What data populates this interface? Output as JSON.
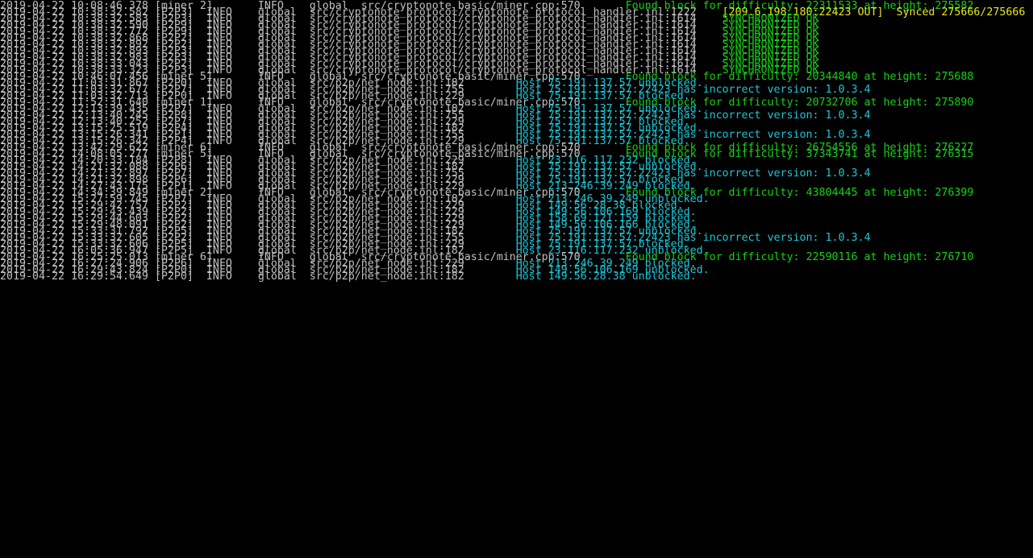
{
  "colors": {
    "background": "#000000",
    "default_text": "#c0c0c0",
    "green": "#16d116",
    "yellow": "#e8e81a",
    "cyan": "#19c8d8"
  },
  "lines": [
    {
      "prefix": "2019-04-22 10:08:46.378 [miner 2]       INFO    global  src/cryptonote_basic/miner.cpp:570       ",
      "msg": "Found block for difficulty: 22311533 at height: 275582",
      "color": "green"
    },
    {
      "prefix": "2019-04-22 10:38:32.582 [P2P3]  INFO    global  src/cryptonote_protocol/cryptonote_protocol_handler.inl:1222    ",
      "msg": "[209.6.198.180:22423 OUT]  Synced 275666/275666",
      "color": "yellow"
    },
    {
      "prefix": "2019-04-22 10:38:32.583 [P2P3]  INFO    global  src/cryptonote_protocol/cryptonote_protocol_handler.inl:1614    ",
      "msg": "SYNCHRONIZED OK",
      "color": "green"
    },
    {
      "prefix": "2019-04-22 10:38:32.590 [P2P9]  INFO    global  src/cryptonote_protocol/cryptonote_protocol_handler.inl:1614    ",
      "msg": "SYNCHRONIZED OK",
      "color": "green"
    },
    {
      "prefix": "2019-04-22 10:38:32.772 [P2P9]  INFO    global  src/cryptonote_protocol/cryptonote_protocol_handler.inl:1614    ",
      "msg": "SYNCHRONIZED OK",
      "color": "green"
    },
    {
      "prefix": "2019-04-22 10:38:32.868 [P2P2]  INFO    global  src/cryptonote_protocol/cryptonote_protocol_handler.inl:1614    ",
      "msg": "SYNCHRONIZED OK",
      "color": "green"
    },
    {
      "prefix": "2019-04-22 10:38:32.892 [P2P2]  INFO    global  src/cryptonote_protocol/cryptonote_protocol_handler.inl:1614    ",
      "msg": "SYNCHRONIZED OK",
      "color": "green"
    },
    {
      "prefix": "2019-04-22 10:38:32.893 [P2P3]  INFO    global  src/cryptonote_protocol/cryptonote_protocol_handler.inl:1614    ",
      "msg": "SYNCHRONIZED OK",
      "color": "green"
    },
    {
      "prefix": "2019-04-22 10:38:32.983 [P2P3]  INFO    global  src/cryptonote_protocol/cryptonote_protocol_handler.inl:1614    ",
      "msg": "SYNCHRONIZED OK",
      "color": "green"
    },
    {
      "prefix": "2019-04-22 10:38:33.043 [P2P2]  INFO    global  src/cryptonote_protocol/cryptonote_protocol_handler.inl:1614    ",
      "msg": "SYNCHRONIZED OK",
      "color": "green"
    },
    {
      "prefix": "2019-04-22 10:38:33.323 [P2P3]  INFO    global  src/cryptonote_protocol/cryptonote_protocol_handler.inl:1614    ",
      "msg": "SYNCHRONIZED OK",
      "color": "green"
    },
    {
      "prefix": "2019-04-22 10:46:07.456 [miner 5]       INFO    global  src/cryptonote_basic/miner.cpp:570       ",
      "msg": "Found block for difficulty: 20344840 at height: 275688",
      "color": "green"
    },
    {
      "prefix": "2019-04-22 11:03:31.867 [P2P0]  INFO    global  src/p2p/net_node.inl:182        ",
      "msg": "Host 75.191.137.57 unblocked.",
      "color": "cyan"
    },
    {
      "prefix": "2019-04-22 11:03:32.677 [P2P7]  INFO    global  src/p2p/net_node.inl:755        ",
      "msg": "Host 75.191.137.57:22423 has incorrect version: 1.0.3.4",
      "color": "cyan"
    },
    {
      "prefix": "2019-04-22 11:03:32.713 [P2P0]  INFO    global  src/p2p/net_node.inl:229        ",
      "msg": "Host 75.191.137.57 blocked.",
      "color": "cyan"
    },
    {
      "prefix": "2019-04-22 11:52:31.640 [miner 1]       INFO    global  src/cryptonote_basic/miner.cpp:570       ",
      "msg": "Found block for difficulty: 20732706 at height: 275890",
      "color": "green"
    },
    {
      "prefix": "2019-04-22 12:13:39.435 [P2P7]  INFO    global  src/p2p/net_node.inl:182        ",
      "msg": "Host 75.191.137.57 unblocked.",
      "color": "cyan"
    },
    {
      "prefix": "2019-04-22 12:13:40.245 [P2P8]  INFO    global  src/p2p/net_node.inl:755        ",
      "msg": "Host 75.191.137.57:22423 has incorrect version: 1.0.3.4",
      "color": "cyan"
    },
    {
      "prefix": "2019-04-22 12:13:40.252 [P2P7]  INFO    global  src/p2p/net_node.inl:229        ",
      "msg": "Host 75.191.137.57 blocked.",
      "color": "cyan"
    },
    {
      "prefix": "2019-04-22 13:15:25.519 [P2P4]  INFO    global  src/p2p/net_node.inl:182        ",
      "msg": "Host 75.191.137.57 unblocked.",
      "color": "cyan"
    },
    {
      "prefix": "2019-04-22 13:15:26.341 [P2P1]  INFO    global  src/p2p/net_node.inl:755        ",
      "msg": "Host 75.191.137.57:22423 has incorrect version: 1.0.3.4",
      "color": "cyan"
    },
    {
      "prefix": "2019-04-22 13:15:26.342 [P2P4]  INFO    global  src/p2p/net_node.inl:229        ",
      "msg": "Host 75.191.137.57 blocked.",
      "color": "cyan"
    },
    {
      "prefix": "2019-04-22 13:42:29.622 [miner 6]       INFO    global  src/cryptonote_basic/miner.cpp:570       ",
      "msg": "Found block for difficulty: 26754556 at height: 276227",
      "color": "green"
    },
    {
      "prefix": "2019-04-22 14:08:05.277 [miner 5]       INFO    global  src/cryptonote_basic/miner.cpp:570       ",
      "msg": "Found block for difficulty: 37343741 at height: 276315",
      "color": "green"
    },
    {
      "prefix": "2019-04-22 14:20:33.184 [P2P8]  INFO    global  src/p2p/net_node.inl:229        ",
      "msg": "Host 23.116.117.232 blocked.",
      "color": "cyan"
    },
    {
      "prefix": "2019-04-22 14:21:32.088 [P2P6]  INFO    global  src/p2p/net_node.inl:182        ",
      "msg": "Host 75.191.137.57 unblocked.",
      "color": "cyan"
    },
    {
      "prefix": "2019-04-22 14:21:32.897 [P2P7]  INFO    global  src/p2p/net_node.inl:755        ",
      "msg": "Host 75.191.137.57:22423 has incorrect version: 1.0.3.4",
      "color": "cyan"
    },
    {
      "prefix": "2019-04-22 14:21:32.898 [P2P6]  INFO    global  src/p2p/net_node.inl:229        ",
      "msg": "Host 75.191.137.57 blocked.",
      "color": "cyan"
    },
    {
      "prefix": "2019-04-22 14:27:43.175 [P2P1]  INFO    global  src/p2p/net_node.inl:229        ",
      "msg": "Host 213.246.39.249 blocked.",
      "color": "cyan"
    },
    {
      "prefix": "2019-04-22 14:34:39.849 [miner 2]       INFO    global  src/cryptonote_basic/miner.cpp:570       ",
      "msg": "Found block for difficulty: 43804445 at height: 276399",
      "color": "green"
    },
    {
      "prefix": "2019-04-22 15:27:59.745 [P2P7]  INFO    global  src/p2p/net_node.inl:182        ",
      "msg": "Host 213.246.39.249 unblocked.",
      "color": "cyan"
    },
    {
      "prefix": "2019-04-22 15:29:42.757 [P2P2]  INFO    global  src/p2p/net_node.inl:229        ",
      "msg": "Host 149.56.28.38 blocked.",
      "color": "cyan"
    },
    {
      "prefix": "2019-04-22 15:29:43.439 [P2P2]  INFO    global  src/p2p/net_node.inl:229        ",
      "msg": "Host 149.56.106.169 blocked.",
      "color": "cyan"
    },
    {
      "prefix": "2019-04-22 15:29:44.603 [P2P2]  INFO    global  src/p2p/net_node.inl:229        ",
      "msg": "Host 158.69.121.159 blocked.",
      "color": "cyan"
    },
    {
      "prefix": "2019-04-22 15:29:48.091 [P2P2]  INFO    global  src/p2p/net_node.inl:229        ",
      "msg": "Host 149.56.106.166 blocked.",
      "color": "cyan"
    },
    {
      "prefix": "2019-04-22 15:33:31.792 [P2P5]  INFO    global  src/p2p/net_node.inl:182        ",
      "msg": "Host 75.191.137.57 unblocked.",
      "color": "cyan"
    },
    {
      "prefix": "2019-04-22 15:33:32.605 [P2P2]  INFO    global  src/p2p/net_node.inl:755        ",
      "msg": "Host 75.191.137.57:22423 has incorrect version: 1.0.3.4",
      "color": "cyan"
    },
    {
      "prefix": "2019-04-22 15:33:32.606 [P2P5]  INFO    global  src/p2p/net_node.inl:229        ",
      "msg": "Host 75.191.137.57 blocked.",
      "color": "cyan"
    },
    {
      "prefix": "2019-04-22 16:05:36.947 [P2P5]  INFO    global  src/p2p/net_node.inl:182        ",
      "msg": "Host 23.116.117.232 unblocked.",
      "color": "cyan"
    },
    {
      "prefix": "2019-04-22 16:25:25.013 [miner 6]       INFO    global  src/cryptonote_basic/miner.cpp:570       ",
      "msg": "Found block for difficulty: 22590116 at height: 276710",
      "color": "green"
    },
    {
      "prefix": "2019-04-22 16:27:24.906 [P2P6]  INFO    global  src/p2p/net_node.inl:229        ",
      "msg": "Host 213.246.39.249 blocked.",
      "color": "cyan"
    },
    {
      "prefix": "2019-04-22 16:29:43.824 [P2P0]  INFO    global  src/p2p/net_node.inl:182        ",
      "msg": "Host 149.56.106.169 unblocked.",
      "color": "cyan"
    },
    {
      "prefix": "2019-04-22 16:29:54.649 [P2P0]  INFO    global  src/p2p/net_node.inl:182        ",
      "msg": "Host 149.56.28.38 unblocked.",
      "color": "cyan"
    }
  ]
}
